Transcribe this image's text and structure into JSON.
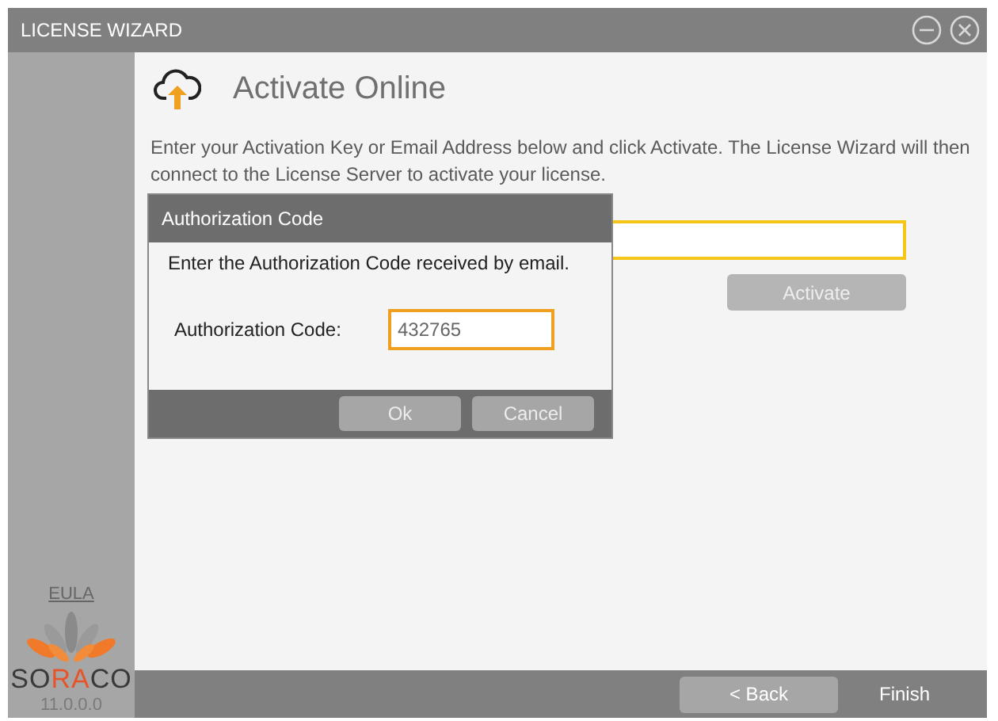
{
  "window": {
    "title": "LICENSE WIZARD"
  },
  "sidebar": {
    "eula_link": "EULA",
    "logo_parts": [
      {
        "text": "SO",
        "color": "#3a3a3a"
      },
      {
        "text": "RA",
        "color": "#e8542a"
      },
      {
        "text": "CO",
        "color": "#3a3a3a"
      }
    ],
    "version": "11.0.0.0"
  },
  "page": {
    "title": "Activate Online",
    "description": "Enter your Activation Key or Email Address below and click Activate. The License Wizard will then connect to the License Server to activate your license.",
    "key_field": {
      "focused": true
    },
    "activate_button": {
      "label": "Activate",
      "disabled": true
    }
  },
  "dialog": {
    "title": "Authorization Code",
    "instruction": "Enter the Authorization Code received by email.",
    "field_label": "Authorization Code:",
    "field_value": "432765",
    "buttons": [
      {
        "label": "Ok"
      },
      {
        "label": "Cancel"
      }
    ]
  },
  "footer": {
    "buttons": [
      {
        "label": "< Back",
        "kind": "button"
      },
      {
        "label": "Finish",
        "kind": "plain"
      }
    ]
  }
}
